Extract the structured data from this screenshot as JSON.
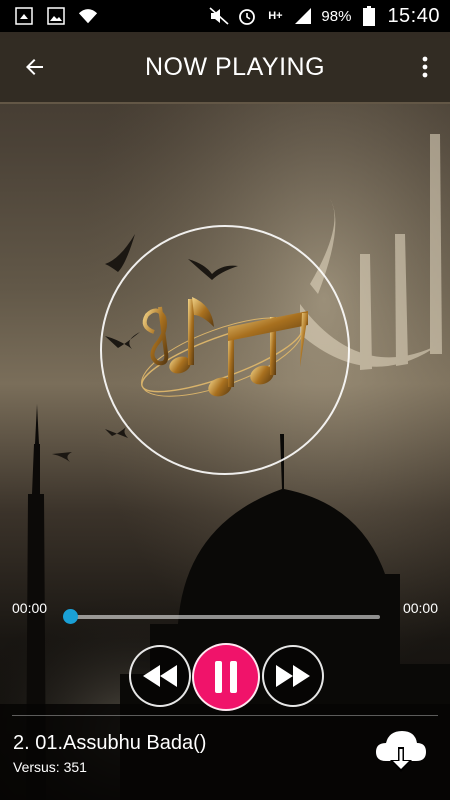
{
  "status_bar": {
    "battery_percent": "98%",
    "time": "15:40",
    "left_icons": [
      "screenshot-icon",
      "image-icon",
      "wifi-icon"
    ],
    "right_icons": [
      "mute-icon",
      "alarm-icon",
      "hplus-icon",
      "signal-icon",
      "battery-icon"
    ],
    "network_label": "H+"
  },
  "app_bar": {
    "title": "NOW PLAYING",
    "back_icon": "arrow-left-icon",
    "menu_icon": "more-vert-icon"
  },
  "player": {
    "elapsed": "00:00",
    "total": "00:00",
    "progress": 0,
    "controls": [
      "rewind-icon",
      "pause-icon",
      "fast-forward-icon"
    ],
    "accent_color": "#f0136a",
    "seek_color": "#1aa0d6"
  },
  "track": {
    "title": "2. 01.Assubhu Bada()",
    "verses_label": "Versus:",
    "verses_count": "351",
    "download_icon": "cloud-download-icon"
  }
}
